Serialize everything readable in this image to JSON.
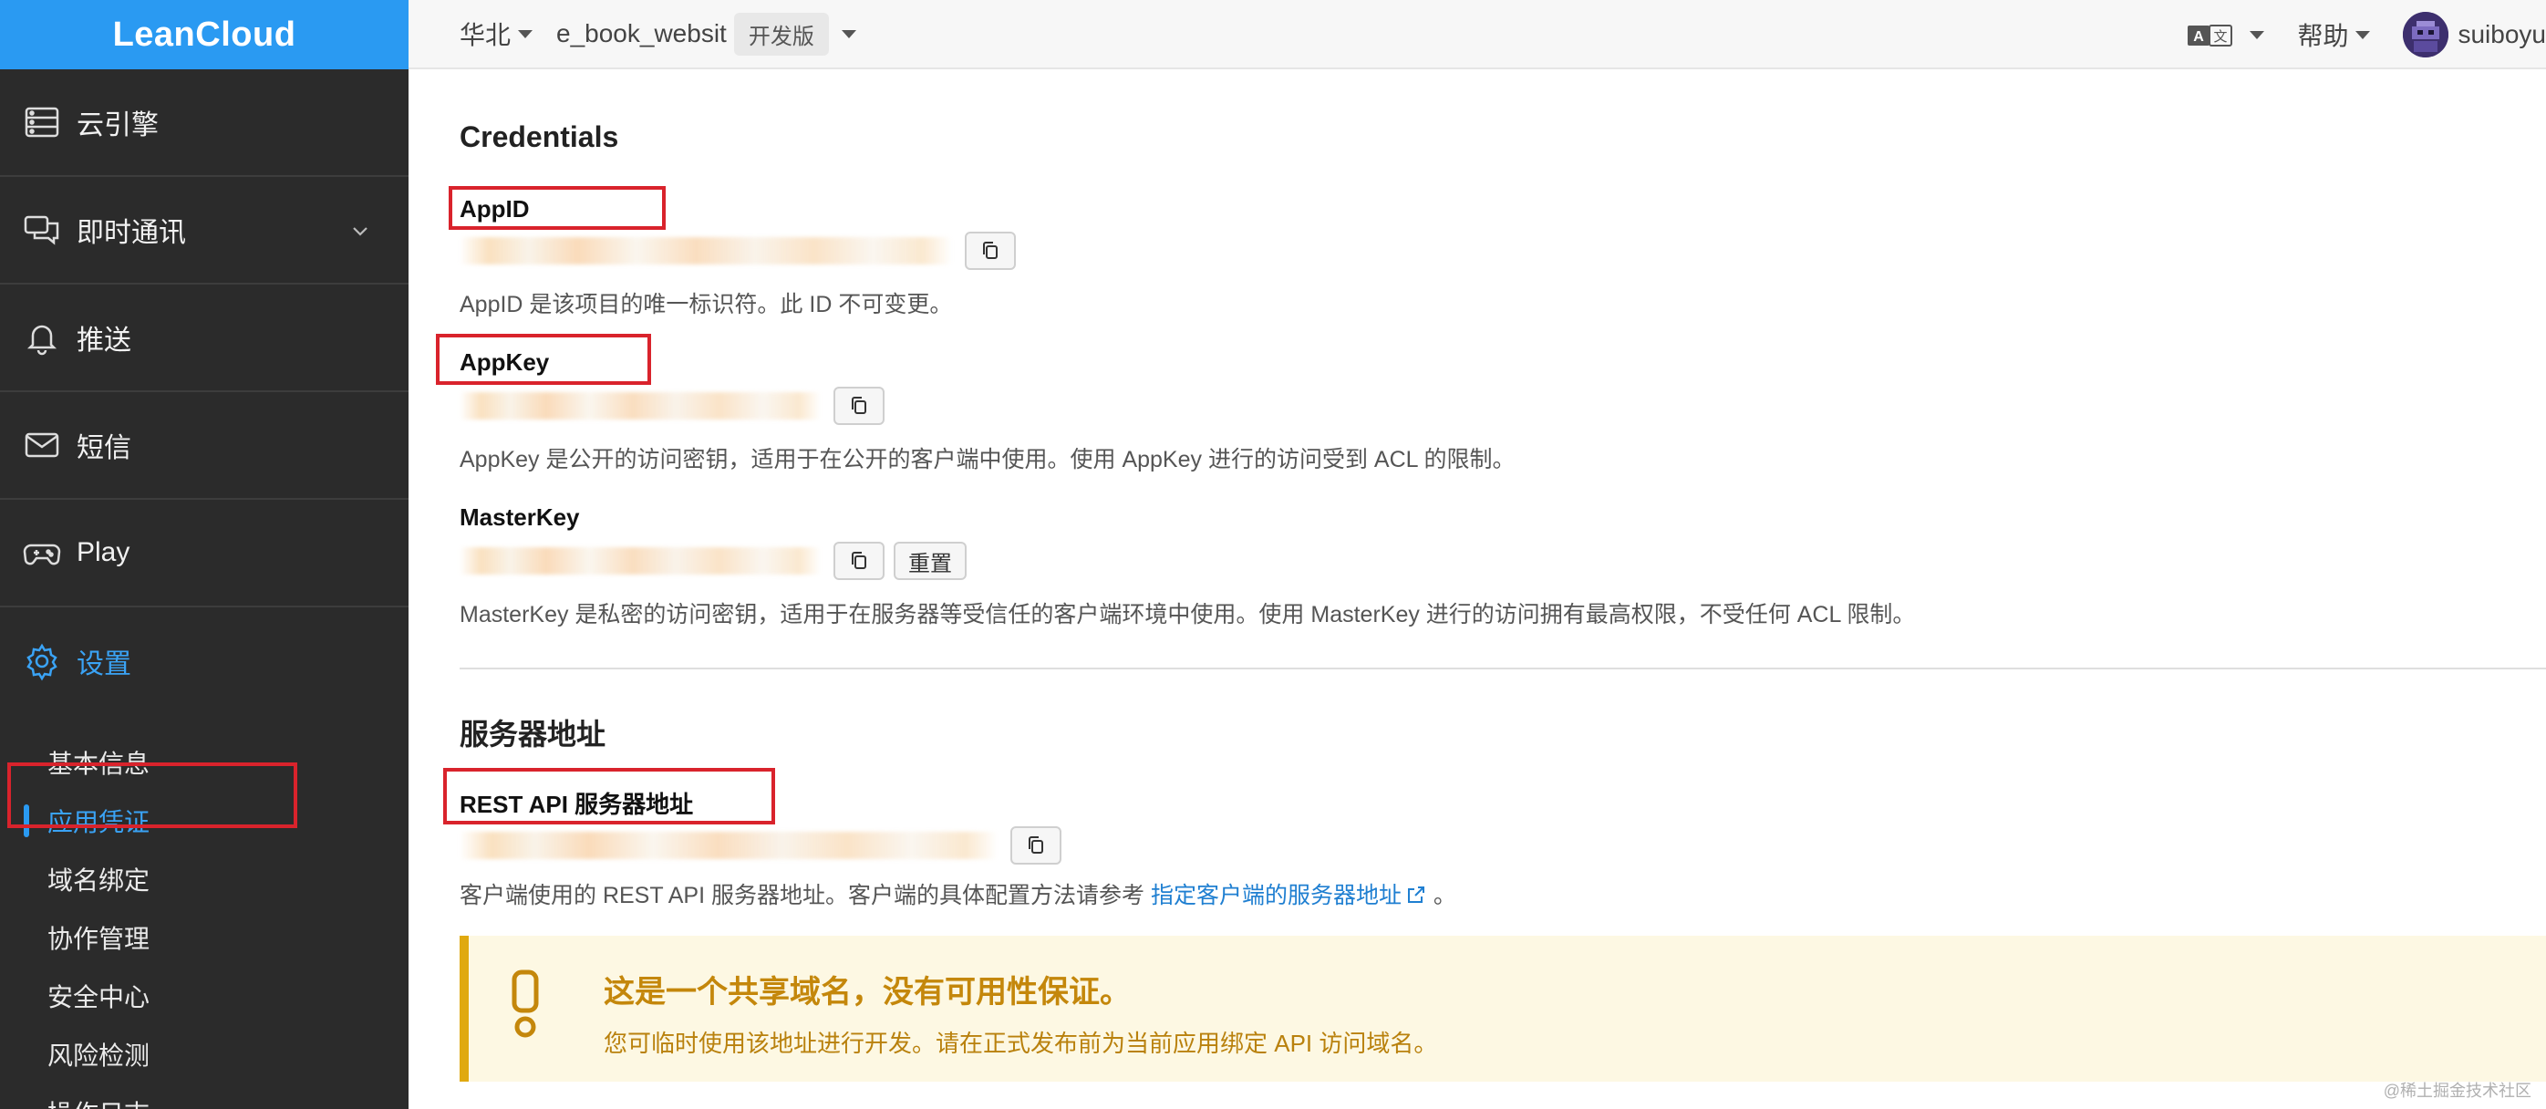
{
  "sidebar": {
    "brand": "LeanCloud",
    "nav": [
      {
        "label": "云引擎",
        "icon": "server-icon"
      },
      {
        "label": "即时通讯",
        "icon": "chat-icon"
      },
      {
        "label": "推送",
        "icon": "bell-icon"
      },
      {
        "label": "短信",
        "icon": "mail-icon"
      },
      {
        "label": "Play",
        "icon": "gamepad-icon"
      },
      {
        "label": "设置",
        "icon": "gear-icon"
      }
    ],
    "sub_items": [
      {
        "label": "基本信息"
      },
      {
        "label": "应用凭证"
      },
      {
        "label": "域名绑定"
      },
      {
        "label": "协作管理"
      },
      {
        "label": "安全中心"
      },
      {
        "label": "风险检测"
      },
      {
        "label": "操作日志"
      }
    ],
    "active_sub": "应用凭证"
  },
  "topbar": {
    "region": "华北",
    "app_name": "e_book_websit",
    "env": "开发版",
    "help": "帮助",
    "username": "suiboyu"
  },
  "credentials": {
    "title": "Credentials",
    "appid": {
      "label": "AppID",
      "help": "AppID 是该项目的唯一标识符。此 ID 不可变更。"
    },
    "appkey": {
      "label": "AppKey",
      "help": "AppKey 是公开的访问密钥，适用于在公开的客户端中使用。使用 AppKey 进行的访问受到 ACL 的限制。"
    },
    "masterkey": {
      "label": "MasterKey",
      "reset": "重置",
      "help": "MasterKey 是私密的访问密钥，适用于在服务器等受信任的客户端环境中使用。使用 MasterKey 进行的访问拥有最高权限，不受任何 ACL 限制。"
    }
  },
  "server": {
    "title": "服务器地址",
    "rest_label": "REST API 服务器地址",
    "help_prefix": "客户端使用的 REST API 服务器地址。客户端的具体配置方法请参考",
    "help_link": "指定客户端的服务器地址",
    "help_suffix": "。"
  },
  "warning": {
    "title": "这是一个共享域名，没有可用性保证。",
    "body": "您可临时使用该地址进行开发。请在正式发布前为当前应用绑定 API 访问域名。"
  },
  "watermark": "@稀土掘金技术社区",
  "colors": {
    "brand": "#2a9af2",
    "sidebar_bg": "#2b2b2b",
    "highlight": "#d9232c",
    "warning": "#e0a90f",
    "link": "#1f7fd1"
  }
}
